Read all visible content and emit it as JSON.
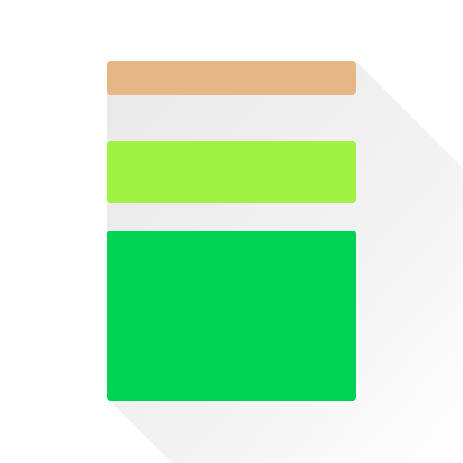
{
  "icon": {
    "name": "stacked-layers-icon",
    "background_color": "#ffffff",
    "shadow_color": "#ececec",
    "blocks": [
      {
        "name": "top-block",
        "color": "#e5b784"
      },
      {
        "name": "middle-block",
        "color": "#a1f343"
      },
      {
        "name": "bottom-block",
        "color": "#00d256"
      }
    ]
  }
}
